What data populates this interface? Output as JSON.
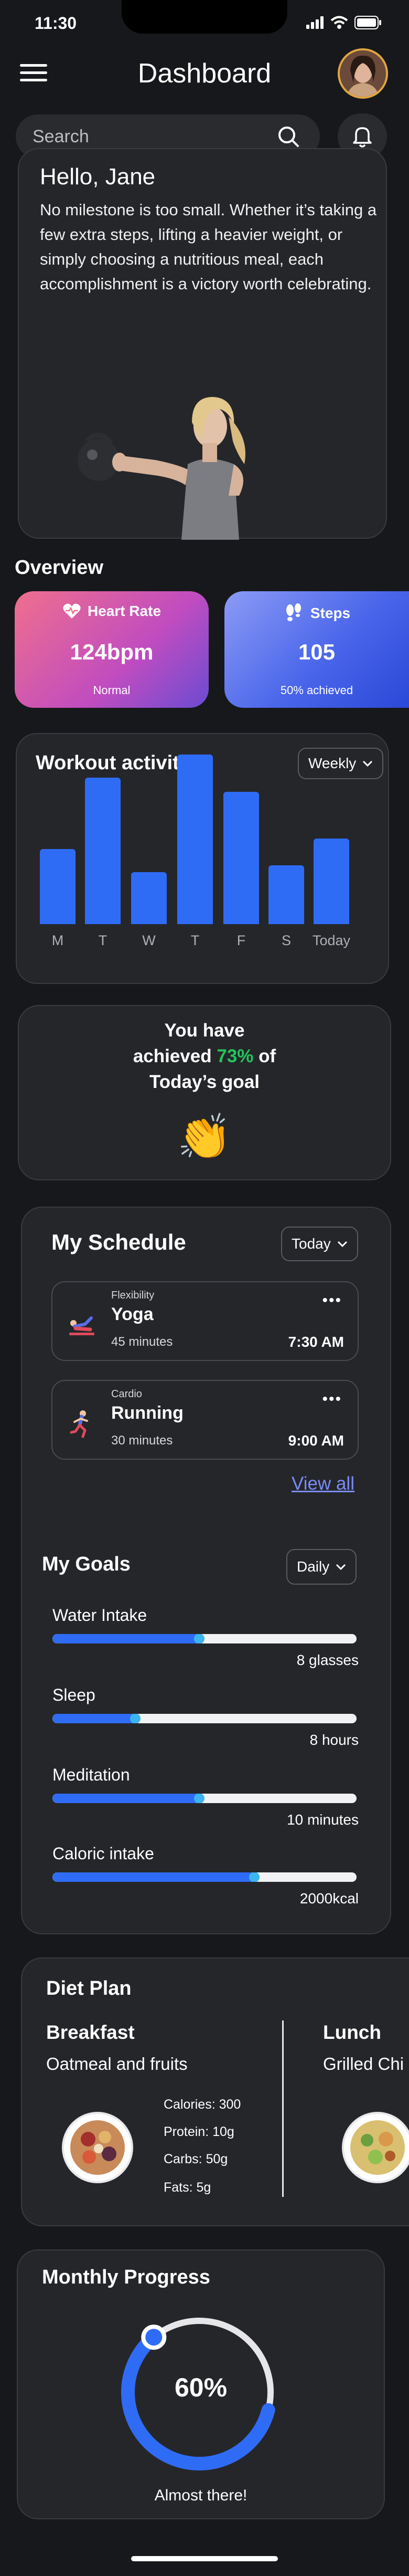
{
  "status_bar": {
    "time": "11:30"
  },
  "header": {
    "title": "Dashboard"
  },
  "search": {
    "placeholder": "Search"
  },
  "greeting": {
    "title": "Hello, Jane",
    "message": "No milestone is too small. Whether it’s taking a few extra steps, lifting a heavier weight, or simply choosing a nutritious meal, each accomplishment is a victory worth celebrating."
  },
  "overview": {
    "title": "Overview",
    "heart_rate": {
      "label": "Heart Rate",
      "value": "124bpm",
      "status": "Normal",
      "icon": "heart-icon"
    },
    "steps": {
      "label": "Steps",
      "value": "105",
      "status": "50% achieved",
      "icon": "footsteps-icon"
    }
  },
  "workout": {
    "title": "Workout activity",
    "period": "Weekly",
    "days": [
      "M",
      "T",
      "W",
      "T",
      "F",
      "S",
      "Today"
    ],
    "values": [
      0.42,
      0.82,
      0.29,
      0.95,
      0.74,
      0.33,
      0.48
    ],
    "bar_color": "#2f6cf6"
  },
  "goal": {
    "line1": "You have",
    "line2_pre": "achieved ",
    "percent": "73%",
    "line2_post": " of",
    "line3": "Today’s goal",
    "emoji": "👏"
  },
  "schedule": {
    "title": "My Schedule",
    "period": "Today",
    "items": [
      {
        "category": "Flexibility",
        "name": "Yoga",
        "duration": "45 minutes",
        "time": "7:30 AM",
        "icon": "yoga-icon"
      },
      {
        "category": "Cardio",
        "name": "Running",
        "duration": "30 minutes",
        "time": "9:00 AM",
        "icon": "running-icon"
      }
    ],
    "view_all": "View all"
  },
  "goals": {
    "title": "My Goals",
    "period": "Daily",
    "items": [
      {
        "label": "Water Intake",
        "value": "8 glasses",
        "progress": 0.49
      },
      {
        "label": "Sleep",
        "value": "8 hours",
        "progress": 0.28
      },
      {
        "label": "Meditation",
        "value": "10 minutes",
        "progress": 0.49
      },
      {
        "label": "Caloric intake",
        "value": "2000kcal",
        "progress": 0.67
      }
    ]
  },
  "diet": {
    "title": "Diet  Plan",
    "breakfast": {
      "meal": "Breakfast",
      "dish": "Oatmeal and fruits",
      "calories": "Calories: 300",
      "protein": "Protein: 10g",
      "carbs": "Carbs: 50g",
      "fats": "Fats: 5g"
    },
    "lunch": {
      "meal": "Lunch",
      "dish": "Grilled Chi"
    }
  },
  "monthly": {
    "title": "Monthly Progress",
    "percent": "60%",
    "progress": 0.6,
    "caption": "Almost there!"
  }
}
